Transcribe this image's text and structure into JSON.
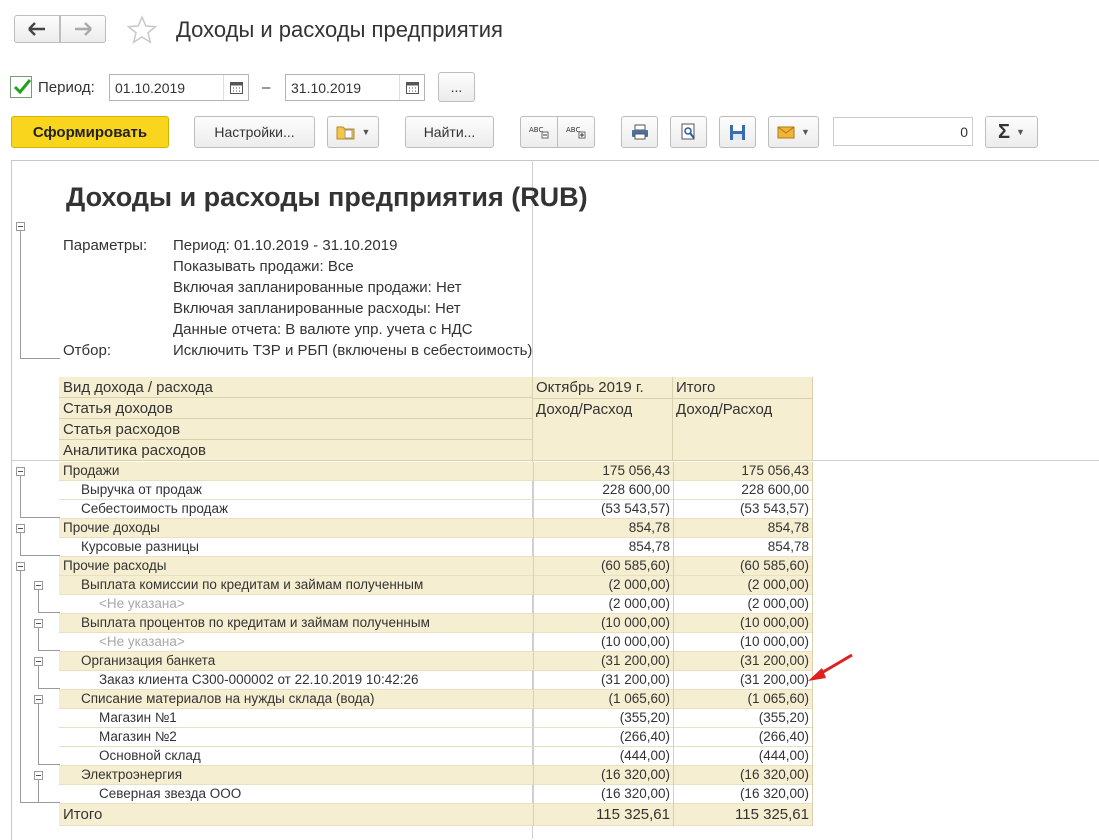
{
  "window": {
    "title": "Доходы и расходы предприятия"
  },
  "period": {
    "label": "Период:",
    "from": "01.10.2019",
    "dash": "–",
    "to": "31.10.2019",
    "more": "..."
  },
  "toolbar": {
    "generate": "Сформировать",
    "settings": "Настройки...",
    "find": "Найти...",
    "sum_value": "0",
    "sum_symbol": "Σ"
  },
  "report": {
    "title": "Доходы и расходы предприятия (RUB)",
    "params_label": "Параметры:",
    "params": [
      "Период: 01.10.2019 - 31.10.2019",
      "Показывать продажи: Все",
      "Включая запланированные продажи: Нет",
      "Включая запланированные расходы: Нет",
      "Данные отчета: В валюте упр. учета с НДС"
    ],
    "filter_label": "Отбор:",
    "filter": "Исключить ТЗР и РБП (включены в себестоимость)",
    "headers": {
      "h1": "Вид дохода / расхода",
      "h2": "Статья доходов",
      "h3": "Статья расходов",
      "h4": "Аналитика расходов",
      "col1_top": "Октябрь 2019 г.",
      "col1_sub": "Доход/Расход",
      "col2_top": "Итого",
      "col2_sub": "Доход/Расход"
    },
    "rows": [
      {
        "name": "Продажи",
        "v1": "175 056,43",
        "v2": "175 056,43"
      },
      {
        "name": "Выручка от продаж",
        "v1": "228 600,00",
        "v2": "228 600,00"
      },
      {
        "name": "Себестоимость продаж",
        "v1": "(53 543,57)",
        "v2": "(53 543,57)"
      },
      {
        "name": "Прочие доходы",
        "v1": "854,78",
        "v2": "854,78"
      },
      {
        "name": "Курсовые разницы",
        "v1": "854,78",
        "v2": "854,78"
      },
      {
        "name": "Прочие расходы",
        "v1": "(60 585,60)",
        "v2": "(60 585,60)"
      },
      {
        "name": "Выплата комиссии по кредитам и займам полученным",
        "v1": "(2 000,00)",
        "v2": "(2 000,00)"
      },
      {
        "name": "<Не указана>",
        "v1": "(2 000,00)",
        "v2": "(2 000,00)"
      },
      {
        "name": "Выплата процентов по кредитам и займам полученным",
        "v1": "(10 000,00)",
        "v2": "(10 000,00)"
      },
      {
        "name": "<Не указана>",
        "v1": "(10 000,00)",
        "v2": "(10 000,00)"
      },
      {
        "name": "Организация банкета",
        "v1": "(31 200,00)",
        "v2": "(31 200,00)"
      },
      {
        "name": "Заказ клиента С300-000002 от 22.10.2019 10:42:26",
        "v1": "(31 200,00)",
        "v2": "(31 200,00)"
      },
      {
        "name": "Списание материалов на нужды склада (вода)",
        "v1": "(1 065,60)",
        "v2": "(1 065,60)"
      },
      {
        "name": "Магазин №1",
        "v1": "(355,20)",
        "v2": "(355,20)"
      },
      {
        "name": "Магазин №2",
        "v1": "(266,40)",
        "v2": "(266,40)"
      },
      {
        "name": "Основной склад",
        "v1": "(444,00)",
        "v2": "(444,00)"
      },
      {
        "name": "Электроэнергия",
        "v1": "(16 320,00)",
        "v2": "(16 320,00)"
      },
      {
        "name": "Северная звезда ООО",
        "v1": "(16 320,00)",
        "v2": "(16 320,00)"
      }
    ],
    "total": {
      "name": "Итого",
      "v1": "115 325,61",
      "v2": "115 325,61"
    }
  },
  "colors": {
    "accent_yellow": "#f9d51d",
    "header_bg": "#f6eed1",
    "arrow_red": "#e02020"
  }
}
